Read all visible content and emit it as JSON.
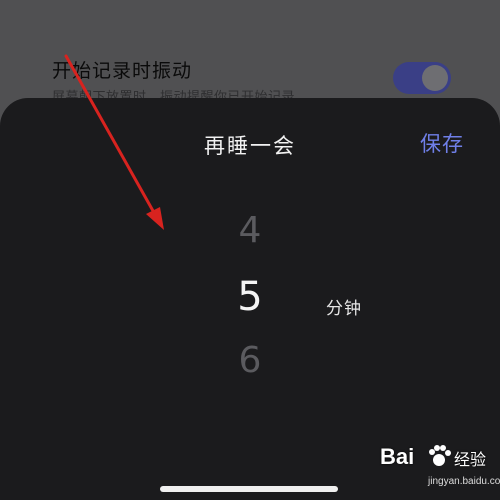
{
  "background_settings": {
    "title": "开始记录时振动",
    "description": "屏幕朝下放置时，振动提醒你已开始记录",
    "toggle_on": true
  },
  "sheet": {
    "title": "再睡一会",
    "save_label": "保存",
    "picker": {
      "previous": "4",
      "current": "5",
      "next": "6",
      "unit": "分钟"
    }
  },
  "watermark": {
    "logo": "Bai",
    "brand": "经验",
    "url": "jingyan.baidu.com"
  },
  "colors": {
    "accent": "#6f7fe8",
    "sheet_bg": "#1b1b1d",
    "arrow": "#d8231f"
  }
}
